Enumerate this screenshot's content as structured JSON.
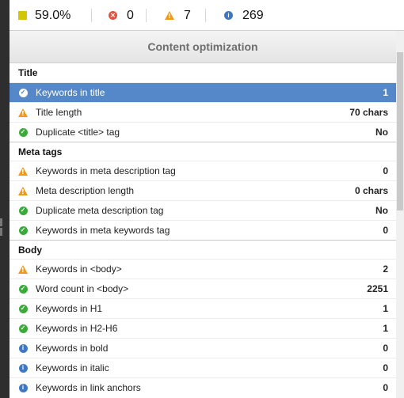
{
  "summary": {
    "score": "59.0%",
    "errors": "0",
    "warnings": "7",
    "info": "269"
  },
  "colors": {
    "score_square": "#d4c600",
    "error": "#e5533d",
    "warning": "#f09a1a",
    "success": "#3aab3a",
    "info": "#3f78c2",
    "selected_row": "#5588c9"
  },
  "panel": {
    "title": "Content optimization",
    "sections": [
      {
        "title": "Title",
        "rows": [
          {
            "status": "success",
            "icon": "check-circle-icon",
            "label": "Keywords in title",
            "value": "1",
            "selected": true
          },
          {
            "status": "warning",
            "icon": "warning-icon",
            "label": "Title length",
            "value": "70 chars"
          },
          {
            "status": "success",
            "icon": "check-circle-icon",
            "label": "Duplicate <title> tag",
            "value": "No"
          }
        ]
      },
      {
        "title": "Meta tags",
        "rows": [
          {
            "status": "warning",
            "icon": "warning-icon",
            "label": "Keywords in meta description tag",
            "value": "0"
          },
          {
            "status": "warning",
            "icon": "warning-icon",
            "label": "Meta description length",
            "value": "0 chars"
          },
          {
            "status": "success",
            "icon": "check-circle-icon",
            "label": "Duplicate meta description tag",
            "value": "No"
          },
          {
            "status": "success",
            "icon": "check-circle-icon",
            "label": "Keywords in meta keywords tag",
            "value": "0"
          }
        ]
      },
      {
        "title": "Body",
        "rows": [
          {
            "status": "warning",
            "icon": "warning-icon",
            "label": "Keywords in <body>",
            "value": "2"
          },
          {
            "status": "success",
            "icon": "check-circle-icon",
            "label": "Word count in <body>",
            "value": "2251"
          },
          {
            "status": "success",
            "icon": "check-circle-icon",
            "label": "Keywords in H1",
            "value": "1"
          },
          {
            "status": "success",
            "icon": "check-circle-icon",
            "label": "Keywords in H2-H6",
            "value": "1"
          },
          {
            "status": "info",
            "icon": "info-icon",
            "label": "Keywords in bold",
            "value": "0"
          },
          {
            "status": "info",
            "icon": "info-icon",
            "label": "Keywords in italic",
            "value": "0"
          },
          {
            "status": "info",
            "icon": "info-icon",
            "label": "Keywords in link anchors",
            "value": "0"
          }
        ]
      }
    ]
  }
}
